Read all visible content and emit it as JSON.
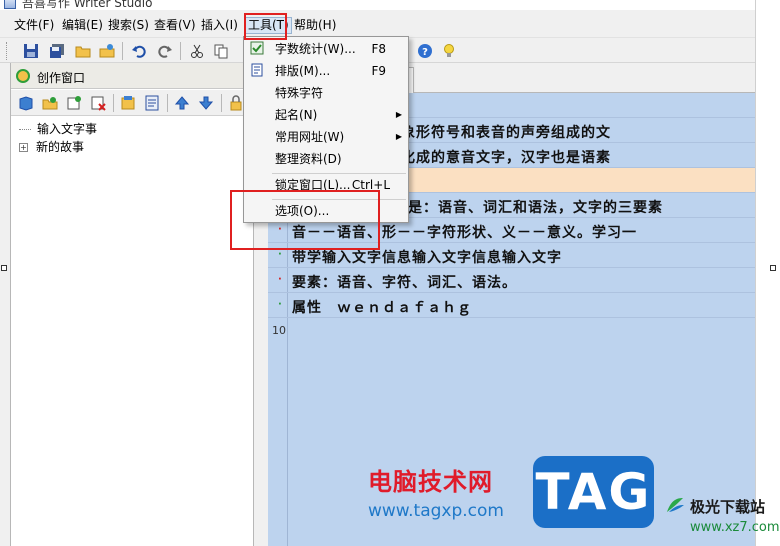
{
  "window": {
    "title": "吾喜写作 Writer Studio"
  },
  "menubar": {
    "items": [
      "文件(F)",
      "编辑(E)",
      "搜索(S)",
      "查看(V)",
      "插入(I)",
      "工具(T)",
      "帮助(H)"
    ]
  },
  "tools_menu": {
    "items": [
      {
        "label": "字数统计(W)...",
        "shortcut": "F8"
      },
      {
        "label": "排版(M)...",
        "shortcut": "F9"
      },
      {
        "label": "特殊字符",
        "shortcut": ""
      },
      {
        "label": "起名(N)",
        "shortcut": ""
      },
      {
        "label": "常用网址(W)",
        "shortcut": ""
      },
      {
        "label": "整理资料(D)",
        "shortcut": ""
      },
      {
        "label": "锁定窗口(L)...",
        "shortcut": "Ctrl+L"
      },
      {
        "label": "选项(O)...",
        "shortcut": ""
      }
    ]
  },
  "left_panel": {
    "title": "创作窗口",
    "tree": [
      "输入文字事",
      "新的故事"
    ]
  },
  "editor": {
    "lines": [
      "表义的象形符号和表音的声旁组成的文",
      "文字进化成的意音文字，汉字也是语素",
      "",
      "是：语音、词汇和语法，文字的三要素",
      "音－－语音、形－－字符形状、义－－意义。学习一",
      "带学输入文字信息输入文字信息输入文字",
      "要素：语音、字符、词汇、语法。",
      "属性　ｗｅｎｄａｆａｈｇ"
    ],
    "line_number": "10"
  },
  "watermark": {
    "brand_text": "电脑技术网",
    "brand_url": "www.tagxp.com",
    "tag": "TAG",
    "site_name": "极光下载站",
    "site_url": "www.xz7.com"
  }
}
